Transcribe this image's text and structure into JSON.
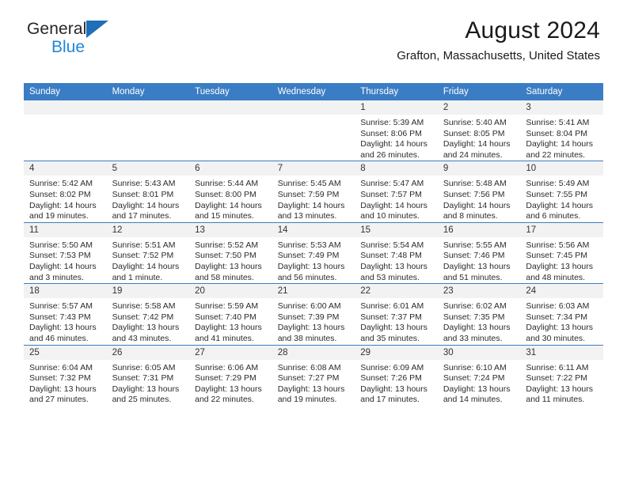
{
  "brand": {
    "name_part1": "General",
    "name_part2": "Blue",
    "flag_icon": "triangle-flag-icon",
    "accent_color": "#1f87d9"
  },
  "header": {
    "title": "August 2024",
    "location": "Grafton, Massachusetts, United States"
  },
  "calendar": {
    "header_bg": "#3b7dc4",
    "daynum_bg": "#f2f2f2",
    "weekdays": [
      "Sunday",
      "Monday",
      "Tuesday",
      "Wednesday",
      "Thursday",
      "Friday",
      "Saturday"
    ],
    "weeks": [
      [
        {
          "day": "",
          "lines": []
        },
        {
          "day": "",
          "lines": []
        },
        {
          "day": "",
          "lines": []
        },
        {
          "day": "",
          "lines": []
        },
        {
          "day": "1",
          "lines": [
            "Sunrise: 5:39 AM",
            "Sunset: 8:06 PM",
            "Daylight: 14 hours",
            "and 26 minutes."
          ]
        },
        {
          "day": "2",
          "lines": [
            "Sunrise: 5:40 AM",
            "Sunset: 8:05 PM",
            "Daylight: 14 hours",
            "and 24 minutes."
          ]
        },
        {
          "day": "3",
          "lines": [
            "Sunrise: 5:41 AM",
            "Sunset: 8:04 PM",
            "Daylight: 14 hours",
            "and 22 minutes."
          ]
        }
      ],
      [
        {
          "day": "4",
          "lines": [
            "Sunrise: 5:42 AM",
            "Sunset: 8:02 PM",
            "Daylight: 14 hours",
            "and 19 minutes."
          ]
        },
        {
          "day": "5",
          "lines": [
            "Sunrise: 5:43 AM",
            "Sunset: 8:01 PM",
            "Daylight: 14 hours",
            "and 17 minutes."
          ]
        },
        {
          "day": "6",
          "lines": [
            "Sunrise: 5:44 AM",
            "Sunset: 8:00 PM",
            "Daylight: 14 hours",
            "and 15 minutes."
          ]
        },
        {
          "day": "7",
          "lines": [
            "Sunrise: 5:45 AM",
            "Sunset: 7:59 PM",
            "Daylight: 14 hours",
            "and 13 minutes."
          ]
        },
        {
          "day": "8",
          "lines": [
            "Sunrise: 5:47 AM",
            "Sunset: 7:57 PM",
            "Daylight: 14 hours",
            "and 10 minutes."
          ]
        },
        {
          "day": "9",
          "lines": [
            "Sunrise: 5:48 AM",
            "Sunset: 7:56 PM",
            "Daylight: 14 hours",
            "and 8 minutes."
          ]
        },
        {
          "day": "10",
          "lines": [
            "Sunrise: 5:49 AM",
            "Sunset: 7:55 PM",
            "Daylight: 14 hours",
            "and 6 minutes."
          ]
        }
      ],
      [
        {
          "day": "11",
          "lines": [
            "Sunrise: 5:50 AM",
            "Sunset: 7:53 PM",
            "Daylight: 14 hours",
            "and 3 minutes."
          ]
        },
        {
          "day": "12",
          "lines": [
            "Sunrise: 5:51 AM",
            "Sunset: 7:52 PM",
            "Daylight: 14 hours",
            "and 1 minute."
          ]
        },
        {
          "day": "13",
          "lines": [
            "Sunrise: 5:52 AM",
            "Sunset: 7:50 PM",
            "Daylight: 13 hours",
            "and 58 minutes."
          ]
        },
        {
          "day": "14",
          "lines": [
            "Sunrise: 5:53 AM",
            "Sunset: 7:49 PM",
            "Daylight: 13 hours",
            "and 56 minutes."
          ]
        },
        {
          "day": "15",
          "lines": [
            "Sunrise: 5:54 AM",
            "Sunset: 7:48 PM",
            "Daylight: 13 hours",
            "and 53 minutes."
          ]
        },
        {
          "day": "16",
          "lines": [
            "Sunrise: 5:55 AM",
            "Sunset: 7:46 PM",
            "Daylight: 13 hours",
            "and 51 minutes."
          ]
        },
        {
          "day": "17",
          "lines": [
            "Sunrise: 5:56 AM",
            "Sunset: 7:45 PM",
            "Daylight: 13 hours",
            "and 48 minutes."
          ]
        }
      ],
      [
        {
          "day": "18",
          "lines": [
            "Sunrise: 5:57 AM",
            "Sunset: 7:43 PM",
            "Daylight: 13 hours",
            "and 46 minutes."
          ]
        },
        {
          "day": "19",
          "lines": [
            "Sunrise: 5:58 AM",
            "Sunset: 7:42 PM",
            "Daylight: 13 hours",
            "and 43 minutes."
          ]
        },
        {
          "day": "20",
          "lines": [
            "Sunrise: 5:59 AM",
            "Sunset: 7:40 PM",
            "Daylight: 13 hours",
            "and 41 minutes."
          ]
        },
        {
          "day": "21",
          "lines": [
            "Sunrise: 6:00 AM",
            "Sunset: 7:39 PM",
            "Daylight: 13 hours",
            "and 38 minutes."
          ]
        },
        {
          "day": "22",
          "lines": [
            "Sunrise: 6:01 AM",
            "Sunset: 7:37 PM",
            "Daylight: 13 hours",
            "and 35 minutes."
          ]
        },
        {
          "day": "23",
          "lines": [
            "Sunrise: 6:02 AM",
            "Sunset: 7:35 PM",
            "Daylight: 13 hours",
            "and 33 minutes."
          ]
        },
        {
          "day": "24",
          "lines": [
            "Sunrise: 6:03 AM",
            "Sunset: 7:34 PM",
            "Daylight: 13 hours",
            "and 30 minutes."
          ]
        }
      ],
      [
        {
          "day": "25",
          "lines": [
            "Sunrise: 6:04 AM",
            "Sunset: 7:32 PM",
            "Daylight: 13 hours",
            "and 27 minutes."
          ]
        },
        {
          "day": "26",
          "lines": [
            "Sunrise: 6:05 AM",
            "Sunset: 7:31 PM",
            "Daylight: 13 hours",
            "and 25 minutes."
          ]
        },
        {
          "day": "27",
          "lines": [
            "Sunrise: 6:06 AM",
            "Sunset: 7:29 PM",
            "Daylight: 13 hours",
            "and 22 minutes."
          ]
        },
        {
          "day": "28",
          "lines": [
            "Sunrise: 6:08 AM",
            "Sunset: 7:27 PM",
            "Daylight: 13 hours",
            "and 19 minutes."
          ]
        },
        {
          "day": "29",
          "lines": [
            "Sunrise: 6:09 AM",
            "Sunset: 7:26 PM",
            "Daylight: 13 hours",
            "and 17 minutes."
          ]
        },
        {
          "day": "30",
          "lines": [
            "Sunrise: 6:10 AM",
            "Sunset: 7:24 PM",
            "Daylight: 13 hours",
            "and 14 minutes."
          ]
        },
        {
          "day": "31",
          "lines": [
            "Sunrise: 6:11 AM",
            "Sunset: 7:22 PM",
            "Daylight: 13 hours",
            "and 11 minutes."
          ]
        }
      ]
    ]
  }
}
